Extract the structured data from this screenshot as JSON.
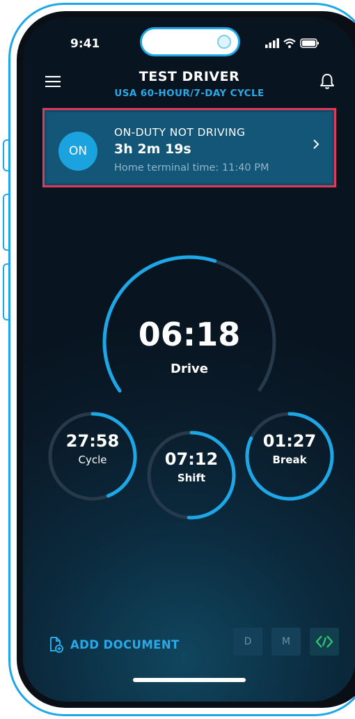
{
  "status_bar": {
    "time": "9:41"
  },
  "header": {
    "driver_name": "TEST DRIVER",
    "cycle": "USA 60-HOUR/7-DAY CYCLE"
  },
  "duty_status": {
    "badge": "ON",
    "label": "ON-DUTY NOT DRIVING",
    "duration": "3h 2m 19s",
    "home_terminal": "Home terminal time: 11:40 PM"
  },
  "timers": {
    "drive": {
      "value": "06:18",
      "label": "Drive",
      "progress": 0.57
    },
    "cycle": {
      "value": "27:58",
      "label": "Cycle",
      "progress": 0.44
    },
    "shift": {
      "value": "07:12",
      "label": "Shift",
      "progress": 0.51
    },
    "break": {
      "value": "01:27",
      "label": "Break",
      "progress": 0.82
    }
  },
  "bottom": {
    "add_document": "ADD DOCUMENT",
    "btn_d": "D",
    "btn_m": "M",
    "connection_icon": "link-connected-icon"
  },
  "colors": {
    "accent": "#29a9e8",
    "track": "#263a4c",
    "highlight": "#e23a5b",
    "connected": "#2fc26a"
  }
}
